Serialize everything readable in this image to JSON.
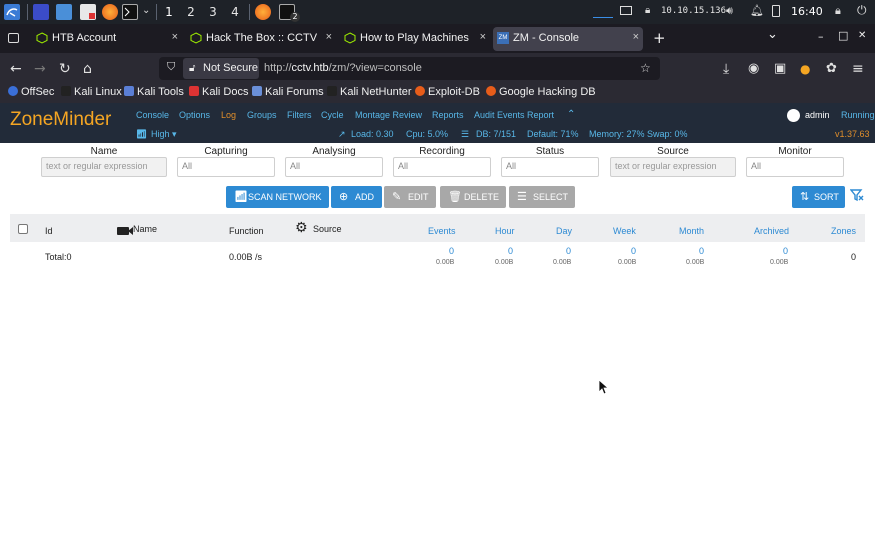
{
  "taskbar": {
    "workspaces": [
      "1",
      "2",
      "3",
      "4"
    ],
    "terminal_badge": "2",
    "ip": "10.10.15.136",
    "clock": "16:40"
  },
  "tabs": [
    {
      "title": "HTB Account",
      "close": "×"
    },
    {
      "title": "Hack The Box :: CCTV Mac",
      "close": "×"
    },
    {
      "title": "How to Play Machines | Ha",
      "close": "×"
    },
    {
      "title": "ZM - Console",
      "close": "×",
      "active": true
    }
  ],
  "tabbar": {
    "new_tab": "+",
    "list": "⌄",
    "minimize": "–",
    "maximize": "□",
    "close": "✕"
  },
  "urlbar": {
    "not_secure": "Not Secure",
    "url_prefix": "http://",
    "url_host": "cctv.htb",
    "url_path": "/zm/?view=console"
  },
  "bookmarks": [
    "OffSec",
    "Kali Linux",
    "Kali Tools",
    "Kali Docs",
    "Kali Forums",
    "Kali NetHunter",
    "Exploit-DB",
    "Google Hacking DB"
  ],
  "zm": {
    "logo": "ZoneMinder",
    "nav": [
      "Console",
      "Options",
      "Log",
      "Groups",
      "Filters",
      "Cycle",
      "Montage Review",
      "Reports",
      "Audit Events Report"
    ],
    "nav_active": "Log",
    "user": "admin",
    "running": "Running",
    "version": "v1.37.63",
    "bandwidth": "High",
    "load": "Load: 0.30",
    "cpu": "Cpu: 5.0%",
    "db": "DB: 7/151",
    "default": "Default: 71%",
    "memory": "Memory: 27% Swap: 0%"
  },
  "filters": [
    {
      "label": "Name",
      "value": "text or regular expression"
    },
    {
      "label": "Capturing",
      "value": "All"
    },
    {
      "label": "Analysing",
      "value": "All"
    },
    {
      "label": "Recording",
      "value": "All"
    },
    {
      "label": "Status",
      "value": "All"
    },
    {
      "label": "Source",
      "value": "text or regular expression"
    },
    {
      "label": "Monitor",
      "value": "All"
    }
  ],
  "buttons": {
    "scan": "SCAN NETWORK",
    "add": "ADD",
    "edit": "EDIT",
    "delete": "DELETE",
    "select": "SELECT",
    "sort": "SORT"
  },
  "table": {
    "headers": [
      "Id",
      "Name",
      "Function",
      "Source",
      "Events",
      "Hour",
      "Day",
      "Week",
      "Month",
      "Archived",
      "Zones"
    ],
    "total_label": "Total:0",
    "function_total": "0.00B /s",
    "events": "0",
    "events_size": "0.00B",
    "hour": "0",
    "hour_size": "0.00B",
    "day": "0",
    "day_size": "0.00B",
    "week": "0",
    "week_size": "0.00B",
    "month": "0",
    "month_size": "0.00B",
    "archived": "0",
    "archived_size": "0.00B",
    "zones": "0"
  },
  "colors": {
    "accent": "#2d8ad3",
    "zm_header": "#222b39",
    "logo": "#f5a623",
    "nav_link": "#58b7e8"
  }
}
